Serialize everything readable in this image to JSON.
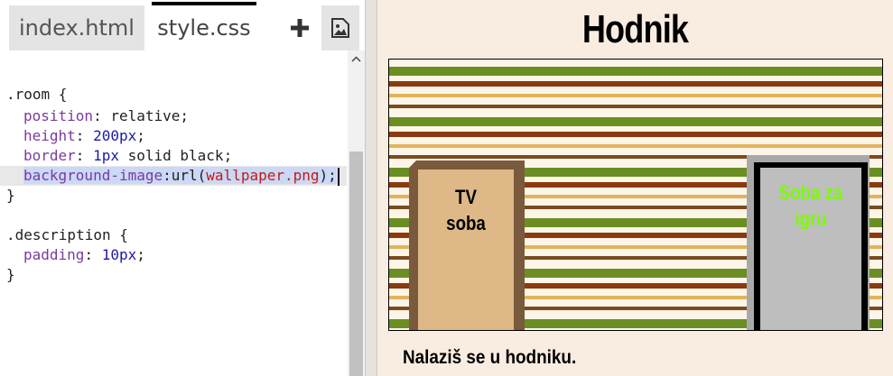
{
  "editor": {
    "tabs": [
      {
        "label": "index.html",
        "active": false
      },
      {
        "label": "style.css",
        "active": true
      }
    ],
    "add_icon": "plus-icon",
    "image_icon": "image-icon",
    "code": {
      "l1_sel": ".room",
      "l1_brace": " {",
      "l2_prop": "position",
      "l2_val": "relative",
      "l3_prop": "height",
      "l3_num": "200",
      "l3_unit": "px",
      "l4_prop": "border",
      "l4_num": "1",
      "l4_unit": "px",
      "l4_rest": " solid black",
      "l5_prop": "background-image",
      "l5_fn": "url(",
      "l5_str": "wallpaper.png",
      "l5_close": ");",
      "l6": "}",
      "l8_sel": ".description",
      "l8_brace": " {",
      "l9_prop": "padding",
      "l9_num": "10",
      "l9_unit": "px",
      "l10": "}"
    }
  },
  "preview": {
    "title": "Hodnik",
    "door_tv_line1": "TV",
    "door_tv_line2": "soba",
    "door_game_line1": "Soba za",
    "door_game_line2": "igru",
    "description": "Nalaziš se u hodniku.",
    "colors": {
      "background": "#f9ede2",
      "stripe_green": "#6b8e23",
      "stripe_brown": "#8b3a0f",
      "stripe_gold": "#e2b45a",
      "door_tv": "#deb887",
      "door_game": "#bebebe",
      "door_game_text": "#7cfc00"
    }
  }
}
